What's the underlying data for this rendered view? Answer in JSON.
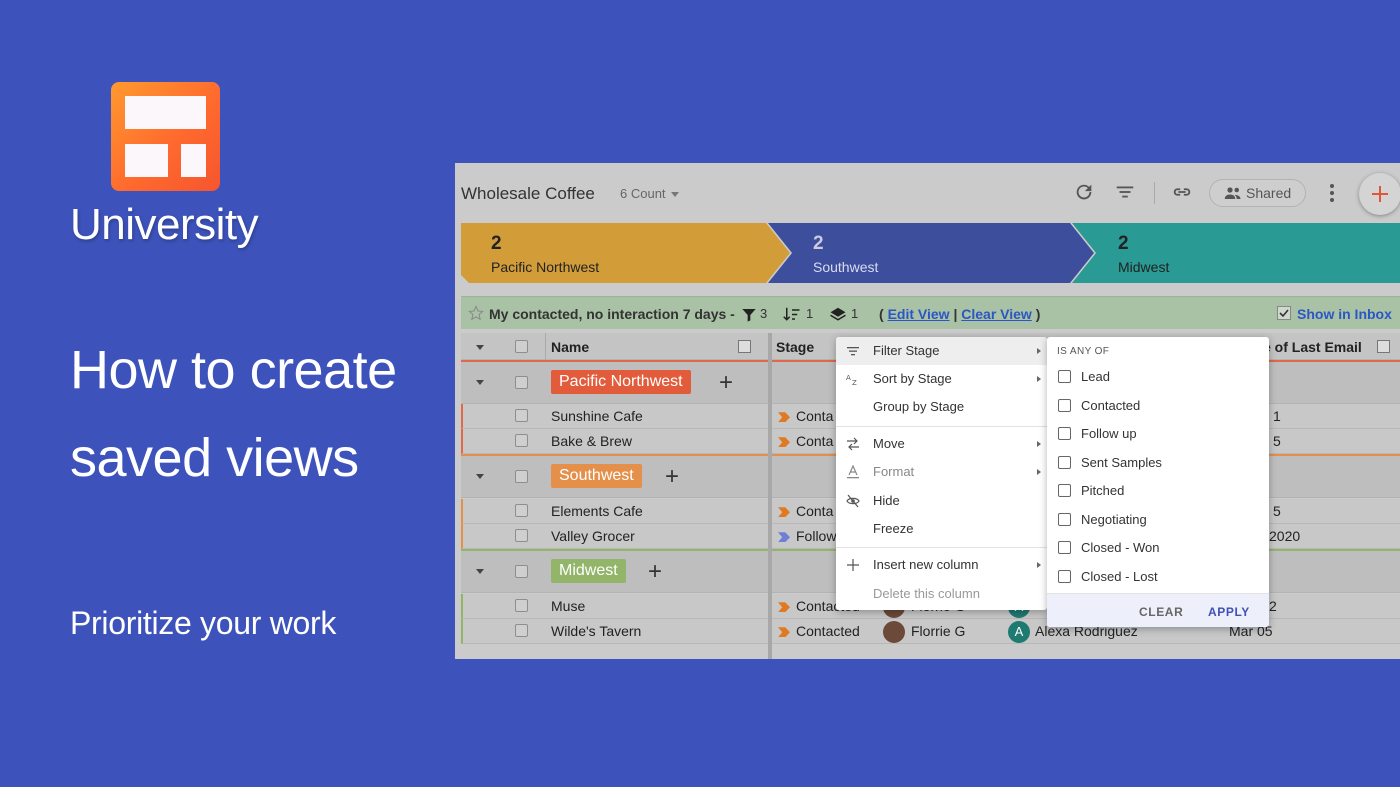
{
  "brand": {
    "name": "University",
    "headline_line1": "How to create",
    "headline_line2": "saved views",
    "subtitle": "Prioritize your work"
  },
  "app": {
    "title": "Wholesale Coffee",
    "count_label": "6 Count",
    "shared_label": "Shared",
    "icons": [
      "refresh-icon",
      "filter-icon",
      "link-icon",
      "people-icon",
      "more-vert-icon",
      "plus-icon"
    ]
  },
  "pipeline": [
    {
      "count": "2",
      "label": "Pacific Northwest",
      "color": "#d29d38"
    },
    {
      "count": "2",
      "label": "Southwest",
      "color": "#3d4e9c"
    },
    {
      "count": "2",
      "label": "Midwest",
      "color": "#2a9a94"
    }
  ],
  "view": {
    "name": "My contacted, no interaction 7 days -",
    "filter_count": "3",
    "sort_count": "1",
    "group_count": "1",
    "edit_label": "Edit View",
    "separator": "|",
    "clear_label": "Clear View",
    "open_paren": "(",
    "close_paren": ")",
    "show_inbox_label": "Show in Inbox"
  },
  "table": {
    "headers": {
      "name": "Name",
      "stage": "Stage",
      "last_email": "e of Last Email"
    },
    "groups": [
      {
        "label": "Pacific Northwest",
        "color": "#e25c3c",
        "line": "#e0694a",
        "rows": [
          {
            "name": "Sunshine Cafe",
            "stage": "Conta",
            "stage_color": "#e07a22",
            "last": "1"
          },
          {
            "name": "Bake & Brew",
            "stage": "Conta",
            "stage_color": "#e07a22",
            "last": "5"
          }
        ]
      },
      {
        "label": "Southwest",
        "color": "#e5904a",
        "line": "#e5904a",
        "rows": [
          {
            "name": "Elements Cafe",
            "stage": "Conta",
            "stage_color": "#e07a22",
            "last": "5"
          },
          {
            "name": "Valley Grocer",
            "stage": "Follow",
            "stage_color": "#6f7fd6",
            "last": "2020"
          }
        ]
      },
      {
        "label": "Midwest",
        "color": "#93b56a",
        "line": "#93b56a",
        "rows": [
          {
            "name": "Muse",
            "stage": "Contacted",
            "stage_color": "#e07a22",
            "owner": "Florrie G",
            "contact": "A",
            "last": "2"
          },
          {
            "name": "Wilde's Tavern",
            "stage": "Contacted",
            "stage_color": "#e07a22",
            "owner": "Florrie G",
            "contact_initial": "A",
            "contact": "Alexa Rodriguez",
            "last": "Mar 05"
          }
        ]
      }
    ]
  },
  "context_menu": {
    "items": [
      {
        "label": "Filter Stage",
        "icon": "filter-lines-icon",
        "submenu": true
      },
      {
        "label": "Sort by Stage",
        "icon": "sort-az-icon",
        "submenu": true
      },
      {
        "label": "Group by Stage",
        "icon": "",
        "submenu": false
      },
      {
        "label": "Move",
        "icon": "swap-icon",
        "submenu": true
      },
      {
        "label": "Format",
        "icon": "format-text-icon",
        "submenu": true
      },
      {
        "label": "Hide",
        "icon": "eye-off-icon",
        "submenu": false
      },
      {
        "label": "Freeze",
        "icon": "",
        "submenu": false
      },
      {
        "label": "Insert new column",
        "icon": "plus-icon",
        "submenu": true
      },
      {
        "label": "Delete this column",
        "icon": "",
        "submenu": false
      }
    ]
  },
  "filter_submenu": {
    "title": "IS ANY OF",
    "options": [
      "Lead",
      "Contacted",
      "Follow up",
      "Sent Samples",
      "Pitched",
      "Negotiating",
      "Closed - Won",
      "Closed - Lost"
    ],
    "clear_label": "CLEAR",
    "apply_label": "APPLY",
    "accent": "#3f51b5"
  }
}
